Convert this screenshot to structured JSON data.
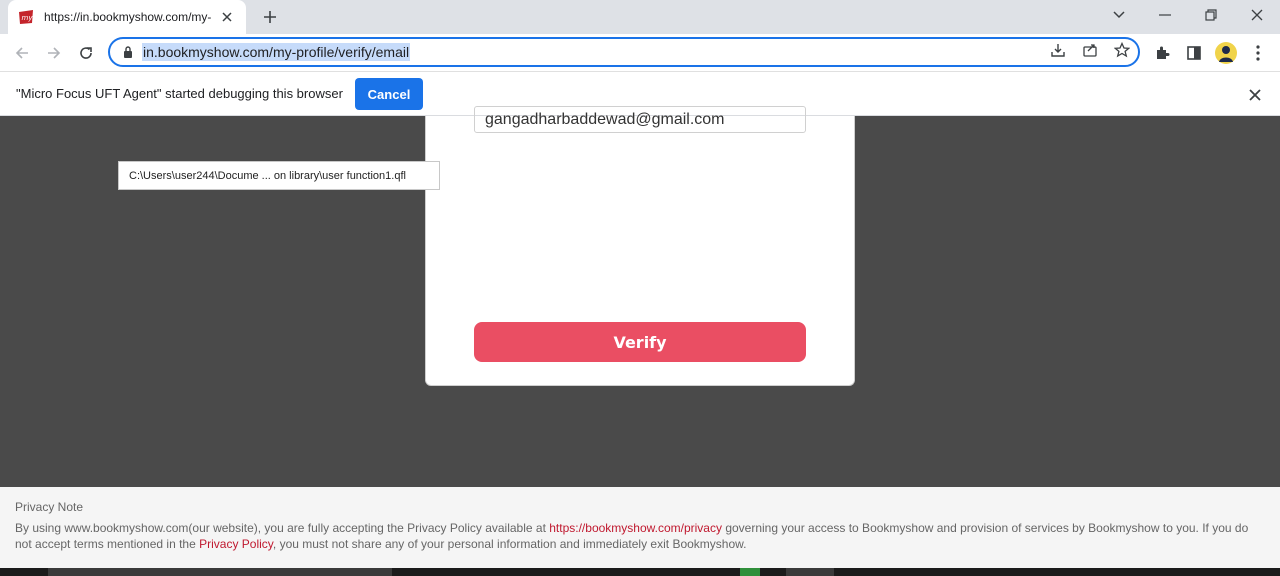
{
  "browser": {
    "tab_title": "https://in.bookmyshow.com/my-",
    "url": "in.bookmyshow.com/my-profile/verify/email"
  },
  "debug_bar": {
    "message": "\"Micro Focus UFT Agent\" started debugging this browser",
    "cancel_label": "Cancel"
  },
  "page": {
    "email_value": "gangadharbaddewad@gmail.com",
    "verify_label": "Verify",
    "tooltip_text": "C:\\Users\\user244\\Docume ... on library\\user function1.qfl"
  },
  "privacy": {
    "title": "Privacy Note",
    "text_1": "By using www.bookmyshow.com(our website), you are fully accepting the Privacy Policy available at ",
    "link_1": "https://bookmyshow.com/privacy",
    "text_2": " governing your access to Bookmyshow and provision of services by Bookmyshow to you. If you do not accept terms mentioned in the ",
    "link_2": "Privacy Policy",
    "text_3": ", you must not share any of your personal information and immediately exit Bookmyshow."
  },
  "colors": {
    "verify_button": "#ea4e63",
    "accent": "#1a73e8",
    "overlay": "#4a4a4a"
  }
}
